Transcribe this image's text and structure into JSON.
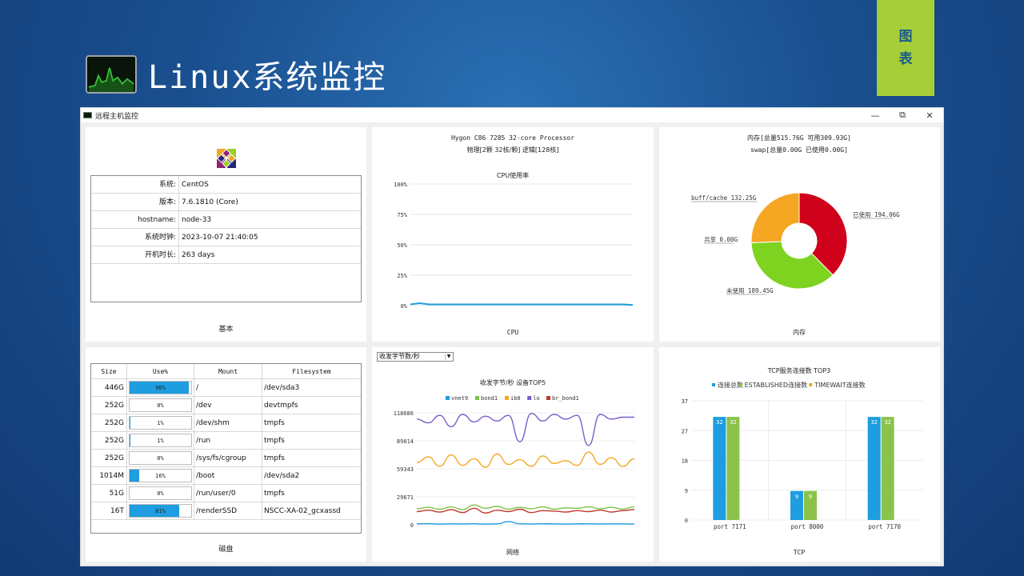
{
  "slide": {
    "title": "Linux系统监控",
    "tag_line1": "图",
    "tag_line2": "表"
  },
  "window": {
    "title": "远程主机监控",
    "buttons": {
      "minimize": "—",
      "restore": "⧉",
      "close": "✕"
    }
  },
  "basic": {
    "footer": "基本",
    "rows": [
      {
        "label": "系统:",
        "value": "CentOS"
      },
      {
        "label": "版本:",
        "value": "7.6.1810 (Core)"
      },
      {
        "label": "hostname:",
        "value": "node-33"
      },
      {
        "label": "系统时钟:",
        "value": "2023-10-07 21:40:05"
      },
      {
        "label": "开机时长:",
        "value": "263 days"
      }
    ]
  },
  "cpu": {
    "footer": "CPU",
    "processor": "Hygon C86 7285 32-core Processor",
    "cores": "物理[2颗 32核/颗] 逻辑[128核]",
    "chart_title": "CPU使用率",
    "y_ticks": [
      "100%",
      "75%",
      "50%",
      "25%",
      "0%"
    ]
  },
  "memory": {
    "footer": "内存",
    "line1": "内存[总量515.76G 可用309.93G]",
    "line2": "swap[总量0.00G 已使用0.00G]",
    "slices": [
      {
        "label": "已使用 194.06G",
        "value": 194.06,
        "color": "#d0021b"
      },
      {
        "label": "未使用 189.45G",
        "value": 189.45,
        "color": "#7ed321"
      },
      {
        "label": "共享 0.00G",
        "value": 0.0,
        "color": "#4a90e2"
      },
      {
        "label": "buff/cache 132.25G",
        "value": 132.25,
        "color": "#f5a623"
      }
    ]
  },
  "disk": {
    "footer": "磁盘",
    "headers": {
      "size": "Size",
      "use": "Use%",
      "mount": "Mount",
      "fs": "Filesystem"
    },
    "rows": [
      {
        "size": "446G",
        "use": "96%",
        "pct": 96,
        "mount": "/",
        "fs": "/dev/sda3"
      },
      {
        "size": "252G",
        "use": "0%",
        "pct": 0,
        "mount": "/dev",
        "fs": "devtmpfs"
      },
      {
        "size": "252G",
        "use": "1%",
        "pct": 1,
        "mount": "/dev/shm",
        "fs": "tmpfs"
      },
      {
        "size": "252G",
        "use": "1%",
        "pct": 1,
        "mount": "/run",
        "fs": "tmpfs"
      },
      {
        "size": "252G",
        "use": "0%",
        "pct": 0,
        "mount": "/sys/fs/cgroup",
        "fs": "tmpfs"
      },
      {
        "size": "1014M",
        "use": "16%",
        "pct": 16,
        "mount": "/boot",
        "fs": "/dev/sda2"
      },
      {
        "size": "51G",
        "use": "0%",
        "pct": 0,
        "mount": "/run/user/0",
        "fs": "tmpfs"
      },
      {
        "size": "16T",
        "use": "81%",
        "pct": 81,
        "mount": "/renderSSD",
        "fs": "NSCC-XA-02_gcxassd"
      }
    ]
  },
  "network": {
    "footer": "网络",
    "select_value": "收发字节数/秒",
    "chart_title": "收发字节/秒 设备TOP5",
    "legend": [
      {
        "name": "vnet9",
        "color": "#1e9de0"
      },
      {
        "name": "bond1",
        "color": "#7cc242"
      },
      {
        "name": "ib0",
        "color": "#f5a623"
      },
      {
        "name": "lo",
        "color": "#7b5cc9"
      },
      {
        "name": "br_bond1",
        "color": "#c0392b"
      }
    ],
    "y_ticks": [
      "118686",
      "89014",
      "59343",
      "29671",
      "0"
    ]
  },
  "tcp": {
    "footer": "TCP",
    "chart_title": "TCP服务连接数 TOP3",
    "legend": [
      {
        "name": "连接总数",
        "color": "#1e9de0"
      },
      {
        "name": "ESTABLISHED连接数",
        "color": "#8bc34a"
      },
      {
        "name": "TIMEWAIT连接数",
        "color": "#f5a623"
      }
    ],
    "y_ticks": [
      "37",
      "27",
      "18",
      "9",
      "0"
    ]
  },
  "chart_data": [
    {
      "type": "line",
      "title": "CPU使用率",
      "xlabel": "",
      "ylabel": "",
      "ylim": [
        0,
        100
      ],
      "series": [
        {
          "values": [
            1,
            2,
            1,
            1,
            1,
            1,
            1,
            1,
            1,
            1,
            1,
            1,
            1,
            1,
            1,
            1,
            1,
            1,
            1,
            1,
            1,
            1,
            1,
            1,
            0.5
          ]
        }
      ]
    },
    {
      "type": "pie",
      "title": "",
      "categories": [
        "已使用",
        "未使用",
        "共享",
        "buff/cache"
      ],
      "values": [
        194.06,
        189.45,
        0.0,
        132.25
      ]
    },
    {
      "type": "line",
      "title": "收发字节/秒 设备TOP5",
      "ylim": [
        0,
        118686
      ],
      "series": [
        {
          "name": "vnet9",
          "values": [
            1000,
            1200,
            800,
            1000,
            900,
            1100,
            800,
            1000,
            3500,
            1000,
            900,
            1100,
            1000,
            800,
            1000,
            1100,
            900,
            1000,
            1000,
            800
          ]
        },
        {
          "name": "bond1",
          "values": [
            17000,
            18500,
            16500,
            19000,
            16000,
            21000,
            17500,
            19500,
            16500,
            18500,
            17000,
            19000,
            16500,
            18000,
            17500,
            19000,
            17000,
            18500,
            16500,
            19000
          ]
        },
        {
          "name": "ib0",
          "values": [
            66000,
            72000,
            62000,
            74000,
            63000,
            70000,
            61000,
            75000,
            64000,
            69000,
            62000,
            73000,
            65000,
            68000,
            63000,
            77000,
            64000,
            71000,
            62000,
            70000
          ]
        },
        {
          "name": "lo",
          "values": [
            112000,
            108000,
            116000,
            104000,
            117000,
            109000,
            115000,
            110000,
            116000,
            88000,
            118000,
            110000,
            117000,
            112000,
            116000,
            84000,
            117000,
            112000,
            114000,
            114000
          ]
        },
        {
          "name": "br_bond1",
          "values": [
            14000,
            15500,
            13500,
            16000,
            13000,
            17500,
            12500,
            15500,
            14000,
            16500,
            13000,
            15000,
            14500,
            13500,
            15000,
            14000,
            15500,
            13500,
            15000,
            16000
          ]
        }
      ]
    },
    {
      "type": "bar",
      "title": "TCP服务连接数 TOP3",
      "categories": [
        "port 7171",
        "port 8000",
        "port 7170"
      ],
      "ylim": [
        0,
        37
      ],
      "series": [
        {
          "name": "连接总数",
          "values": [
            32,
            9,
            32
          ]
        },
        {
          "name": "ESTABLISHED连接数",
          "values": [
            32,
            9,
            32
          ]
        },
        {
          "name": "TIMEWAIT连接数",
          "values": [
            0,
            0,
            0
          ]
        }
      ]
    }
  ]
}
